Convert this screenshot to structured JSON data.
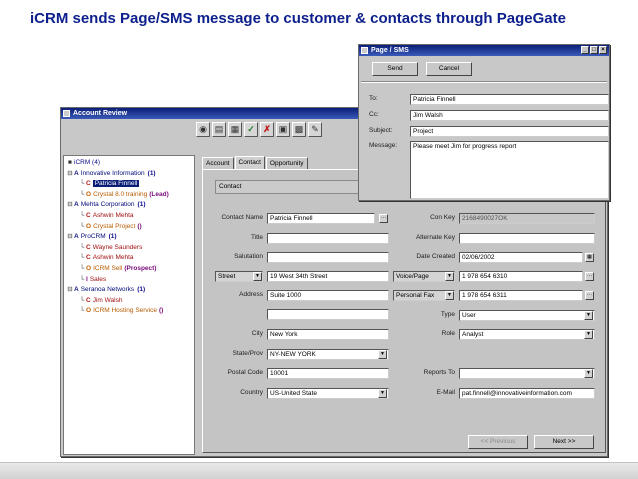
{
  "slide": {
    "title": "iCRM sends Page/SMS message to customer & contacts through PageGate"
  },
  "account_review": {
    "title": "Account Review",
    "toolbar_icons": [
      "binoculars-icon",
      "report-icon",
      "delete-icon",
      "check-icon",
      "cancel-x-icon",
      "calculator-icon",
      "calendar-icon",
      "notepad-icon"
    ],
    "tree": {
      "root": "iCRM (4)",
      "items": [
        {
          "glyph": "⊟",
          "letter": "A",
          "text": "Innovative Information",
          "count": "(1)",
          "kind": "acct",
          "indent": 1
        },
        {
          "glyph": "",
          "letter": "C",
          "text": "Patricia Finnell",
          "kind": "contact-sel",
          "indent": 2
        },
        {
          "glyph": "",
          "letter": "O",
          "text": "Crystal 8.0 training",
          "extra": "(Lead)",
          "kind": "opp",
          "indent": 2
        },
        {
          "glyph": "⊟",
          "letter": "A",
          "text": "Mehta Corporation",
          "count": "(1)",
          "kind": "acct",
          "indent": 1
        },
        {
          "glyph": "",
          "letter": "C",
          "text": "Ashwin  Mehta",
          "kind": "contact",
          "indent": 2
        },
        {
          "glyph": "",
          "letter": "O",
          "text": "Crystal Project",
          "extra": "()",
          "kind": "opp",
          "indent": 2
        },
        {
          "glyph": "⊟",
          "letter": "A",
          "text": "ProCRM",
          "count": "(1)",
          "kind": "acct",
          "indent": 1
        },
        {
          "glyph": "",
          "letter": "C",
          "text": "Wayne Saunders",
          "kind": "contact",
          "indent": 2
        },
        {
          "glyph": "",
          "letter": "C",
          "text": "Ashwin  Mehta",
          "kind": "contact",
          "indent": 2
        },
        {
          "glyph": "",
          "letter": "O",
          "text": "ICRM Sell",
          "extra": "(Prospect)",
          "kind": "opp",
          "indent": 2
        },
        {
          "glyph": "",
          "letter": "I",
          "text": "Sales",
          "kind": "contact",
          "indent": 2
        },
        {
          "glyph": "⊟",
          "letter": "A",
          "text": "Seranoa Networks",
          "count": "(1)",
          "kind": "acct",
          "indent": 1
        },
        {
          "glyph": "",
          "letter": "C",
          "text": "Jim  Walsh",
          "kind": "contact",
          "indent": 2
        },
        {
          "glyph": "",
          "letter": "O",
          "text": "ICRM Hosting Service",
          "extra": "()",
          "kind": "opp",
          "indent": 2
        }
      ]
    },
    "tabs": [
      "Account",
      "Contact",
      "Opportunity"
    ],
    "active_tab": 1,
    "group_label": "Contact",
    "form": {
      "contact_name_label": "Contact Name",
      "contact_name": "Patricia  Finnell",
      "title_label": "Title",
      "title": "",
      "salutation_label": "Salutation",
      "salutation": "",
      "street_type": "Street",
      "street": "19 West 34th Street",
      "address_label": "Address",
      "address": "Suite 1000",
      "address2": "",
      "city_label": "City",
      "city": "New York",
      "state_label": "State/Prov",
      "state": "NY-NEW YORK",
      "postal_label": "Postal Code",
      "postal": "10001",
      "country_label": "Country",
      "country": "US-United State",
      "con_key_label": "Con Key",
      "con_key": "2168490027OK",
      "alt_key_label": "Alternate Key",
      "alt_key": "",
      "date_created_label": "Date Created",
      "date_created": "02/06/2002",
      "phone1_type": "Voice/Page",
      "phone1": "1 978 654 6310",
      "phone2_type": "Personal Fax",
      "phone2": "1 978 654 6311",
      "type_label": "Type",
      "type": "User",
      "role_label": "Role",
      "role": "Analyst",
      "reports_to_label": "Reports To",
      "reports_to": "",
      "email_label": "E-Mail",
      "email": "pat.finnell@innovativeinformation.com"
    },
    "prev_button": "<< Previous",
    "next_button": "Next  >>"
  },
  "page_sms": {
    "title": "Page / SMS",
    "send_label": "Send",
    "cancel_label": "Cancel",
    "to_label": "To:",
    "to": "Patricia Finnell",
    "cc_label": "Cc:",
    "cc": "Jim Walsh",
    "subject_label": "Subject:",
    "subject": "Project",
    "message_label": "Message:",
    "message": "Please meet Jim for progress report"
  }
}
